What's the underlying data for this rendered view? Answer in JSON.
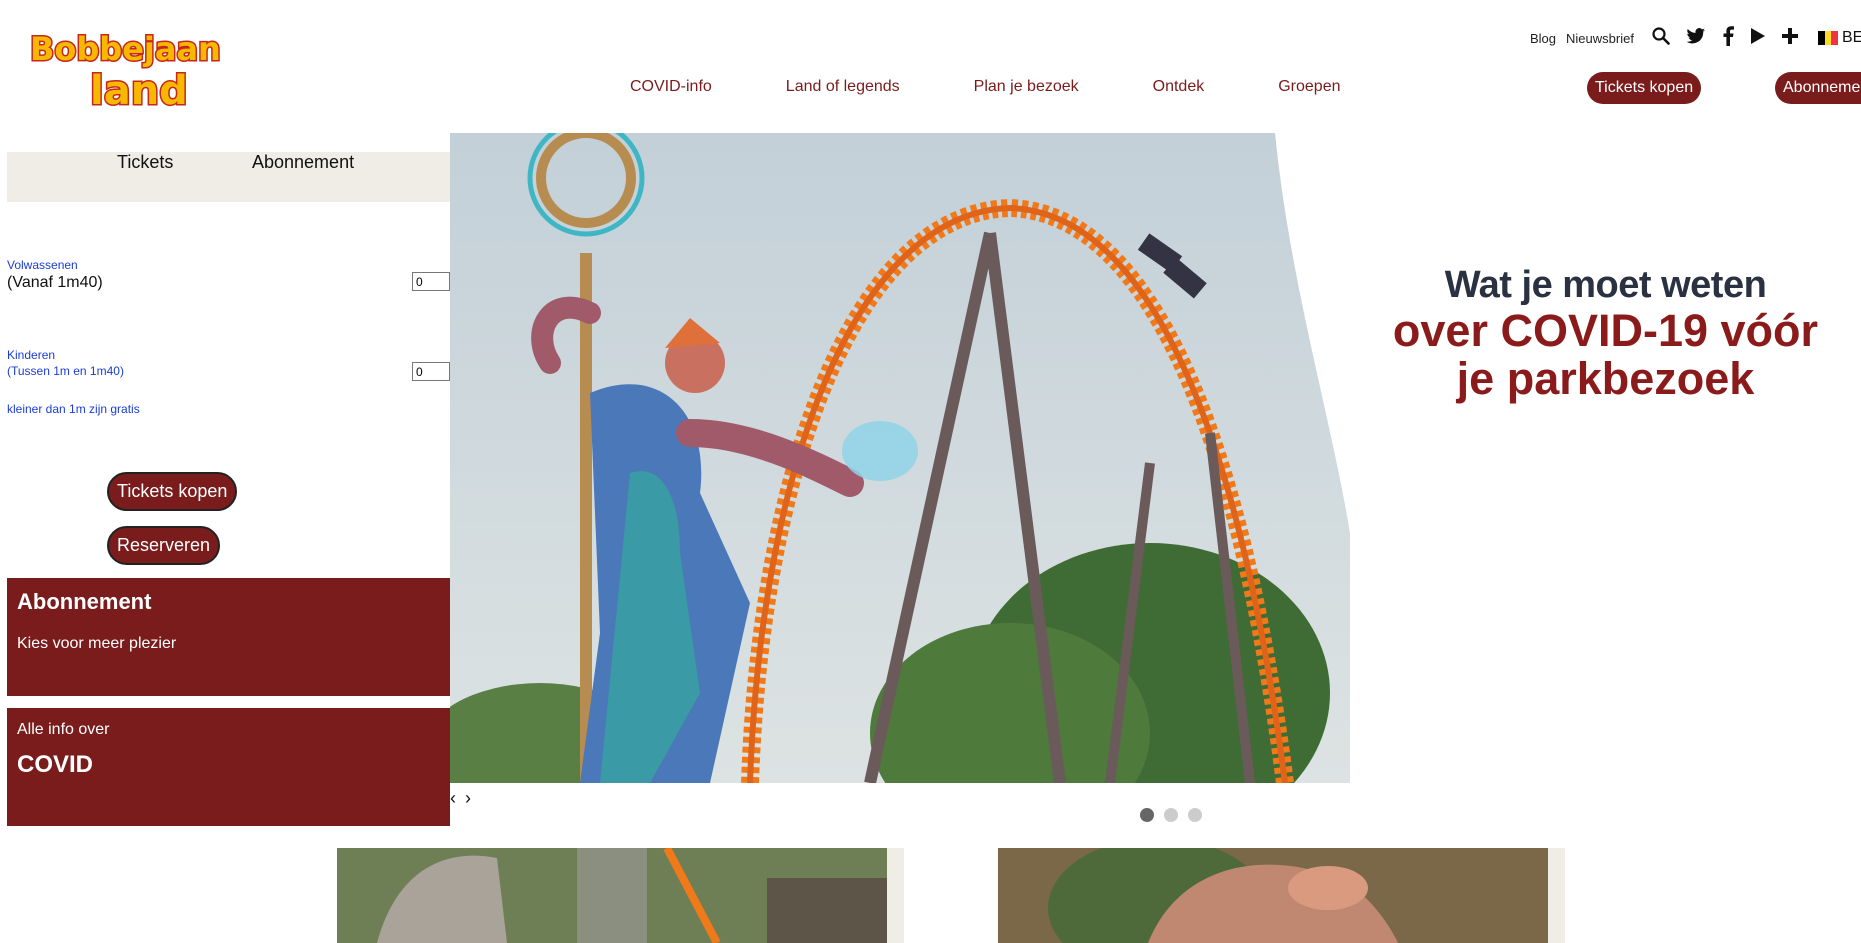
{
  "brand": {
    "name_top": "Bobbejaan",
    "name_bottom": "land"
  },
  "toplinks": {
    "blog": "Blog",
    "newsletter": "Nieuwsbrief",
    "lang": "BE"
  },
  "nav": {
    "items": [
      "COVID-info",
      "Land of legends",
      "Plan je bezoek",
      "Ontdek",
      "Groepen"
    ],
    "tickets": "Tickets kopen",
    "subscription": "Abonnement"
  },
  "widget": {
    "tabs": [
      "Tickets",
      "Abonnement"
    ],
    "adults": {
      "label": "Volwassenen",
      "sub": "(Vanaf 1m40)",
      "qty": "0"
    },
    "children": {
      "label": "Kinderen",
      "sub": "(Tussen 1m en 1m40)",
      "qty": "0"
    },
    "note": "kleiner dan 1m zijn gratis",
    "buy": "Tickets kopen",
    "reserve": "Reserveren"
  },
  "promo": {
    "title": "Abonnement",
    "text": "Kies voor meer plezier"
  },
  "covid": {
    "pre": "Alle info over",
    "title": "COVID"
  },
  "hero": {
    "line1": "Wat je moet weten",
    "line2": "over COVID-19 vóór",
    "line3": "je parkbezoek",
    "prev": "‹",
    "next": "›",
    "slides": 3,
    "active_slide": 1
  },
  "colors": {
    "brand": "#7a1c1c",
    "accent": "#f07a1a",
    "beige": "#efede5"
  }
}
